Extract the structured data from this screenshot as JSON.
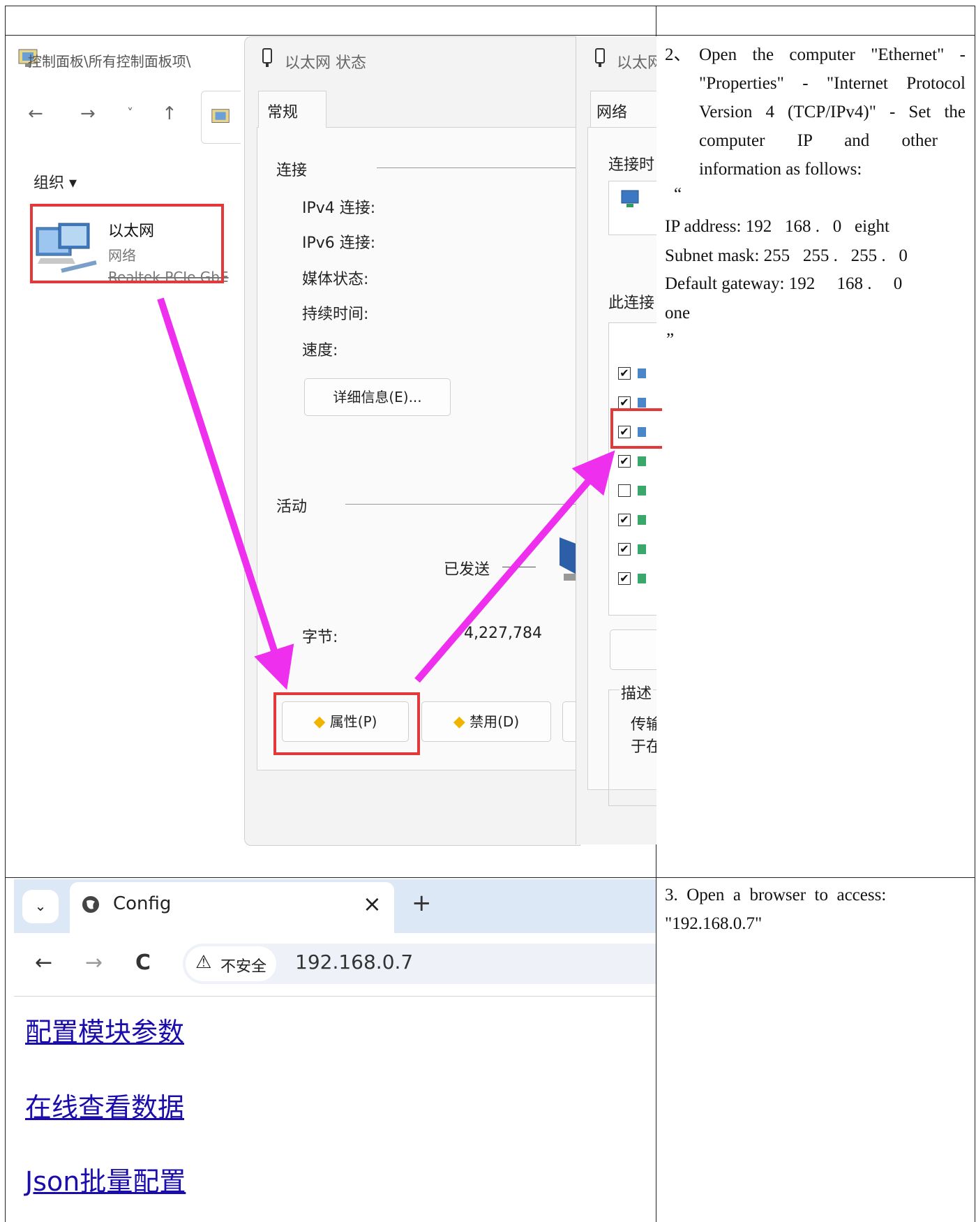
{
  "row1": {
    "control_panel": {
      "title": "控制面板\\所有控制面板项\\",
      "nav": {
        "back": "←",
        "forward": "→",
        "recent": "˅",
        "up": "↑"
      },
      "organize": "组织 ▾",
      "adapter": {
        "name": "以太网",
        "type": "网络",
        "driver": "Realtek PCIe GbE"
      }
    },
    "status_dialog": {
      "title": "以太网 状态",
      "tab": "常规",
      "connection_section": "连接",
      "fields": [
        "IPv4 连接:",
        "IPv6 连接:",
        "媒体状态:",
        "持续时间:",
        "速度:"
      ],
      "details_button": "详细信息(E)...",
      "activity_section": "活动",
      "sent_label": "已发送",
      "bytes_label": "字节:",
      "bytes_sent": "4,227,784",
      "properties_button": "属性(P)",
      "disable_button": "禁用(D)"
    },
    "properties_dialog": {
      "title": "以太网",
      "tab": "网络",
      "connect_using": "连接时",
      "items_label": "此连接",
      "item_checks": [
        true,
        true,
        true,
        true,
        false,
        true,
        true,
        true
      ],
      "description_label": "描述",
      "description_text": [
        "传输",
        "于在"
      ]
    },
    "instruction": {
      "step": "2、",
      "lines": [
        "Open the computer \"Ethernet\" -",
        "\"Properties\" - \"Internet Protocol",
        "Version 4 (TCP/IPv4)\" - Set the",
        "computer IP and other",
        "information as follows:"
      ],
      "open_quote": "“",
      "ip_address": "IP address: 192   168 .   0   eight",
      "subnet_mask": "Subnet mask: 255   255 .   255 .   0",
      "gateway": "Default gateway: 192     168 .     0",
      "gateway_cont": "one",
      "close_quote": "”"
    }
  },
  "row2": {
    "browser": {
      "tab_title": "Config",
      "close": "×",
      "new_tab": "+",
      "nav": {
        "back": "←",
        "forward": "→",
        "reload": "C"
      },
      "security": "不安全",
      "url": "192.168.0.7",
      "links": [
        "配置模块参数",
        "在线查看数据",
        "Json批量配置"
      ]
    },
    "instruction": {
      "line1": "3.  Open  a  browser  to  access:",
      "line2": "\"192.168.0.7\""
    }
  },
  "colors": {
    "highlight_red": "#e23a3a",
    "arrow_magenta": "#ee2fee",
    "link_blue": "#1a0dab"
  }
}
